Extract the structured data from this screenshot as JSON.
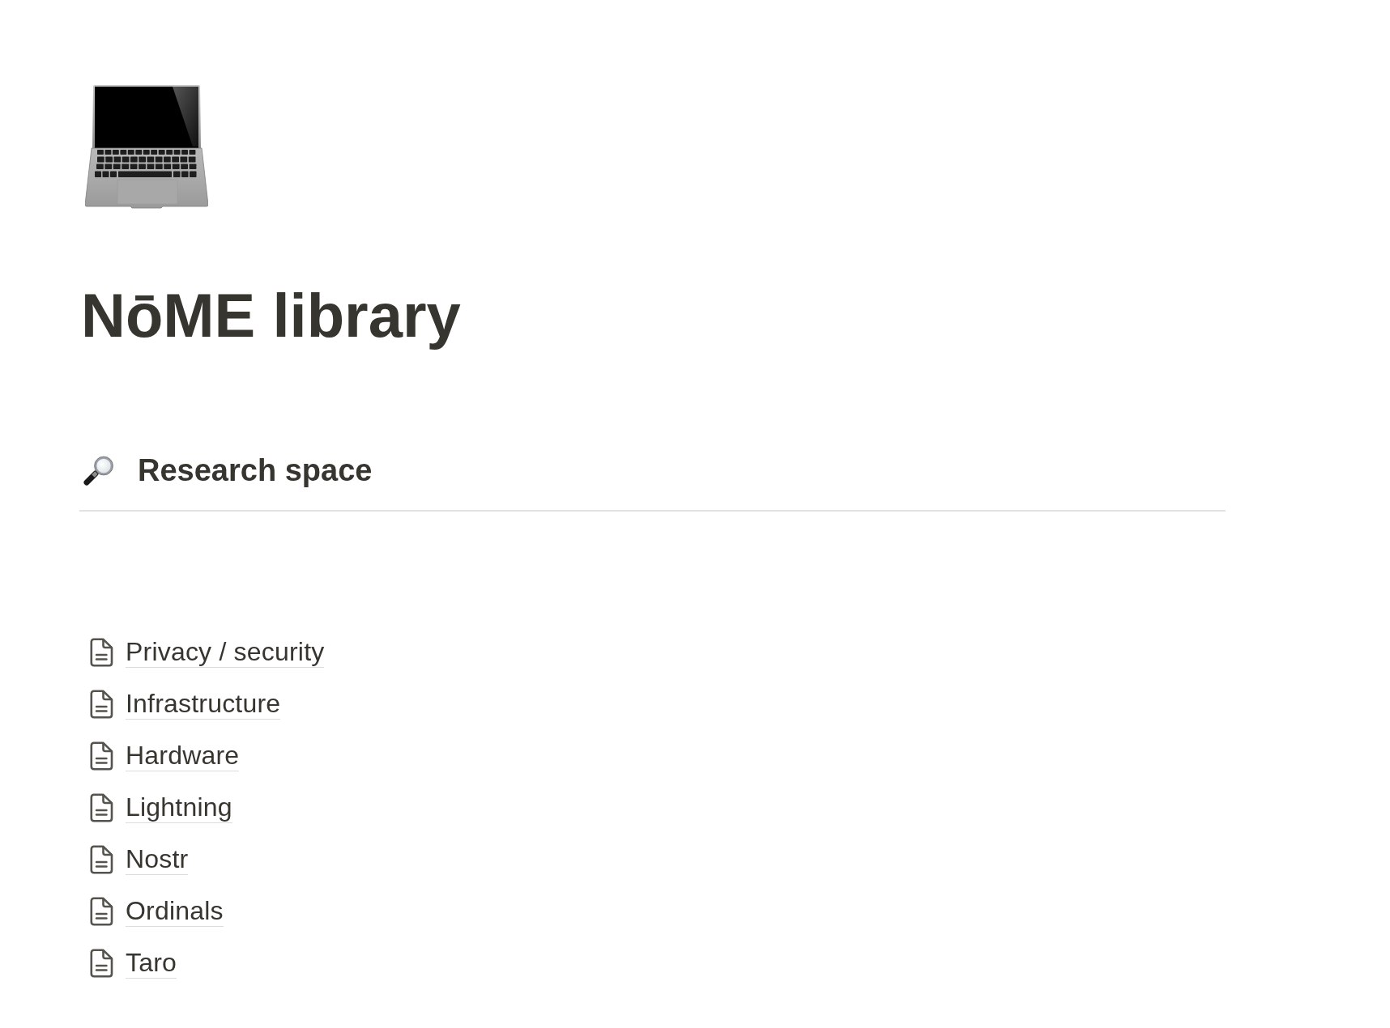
{
  "page": {
    "title": "NōME library"
  },
  "sections": [
    {
      "heading": "Research space",
      "pages": [
        "Privacy / security",
        "Infrastructure",
        "Hardware",
        "Lightning",
        "Nostr",
        "Ordinals",
        "Taro"
      ]
    }
  ]
}
